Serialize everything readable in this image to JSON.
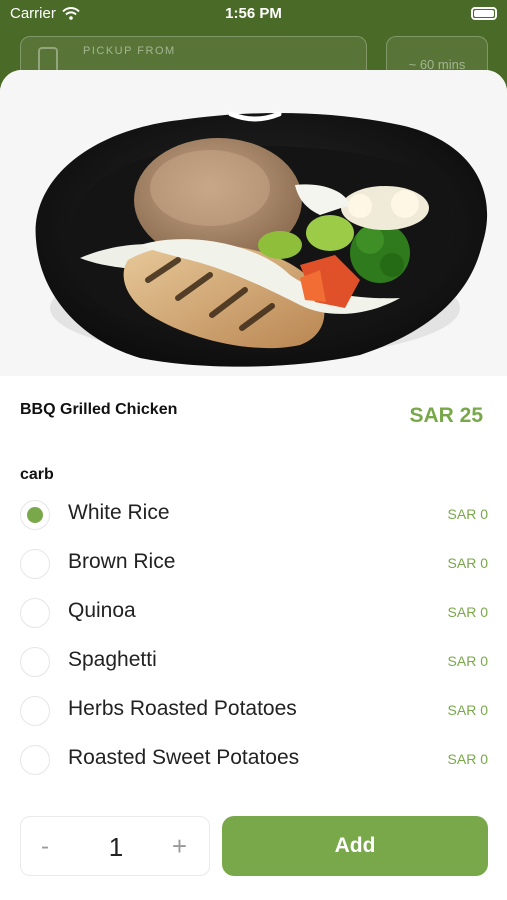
{
  "status_bar": {
    "carrier": "Carrier",
    "time": "1:56 PM"
  },
  "header": {
    "pickup_label": "PICKUP FROM",
    "time_label": "~ 60 mins"
  },
  "product": {
    "name": "BBQ Grilled Chicken",
    "price": "SAR 25"
  },
  "options_group": {
    "title": "carb",
    "options": [
      {
        "label": "White Rice",
        "price": "SAR 0",
        "selected": true
      },
      {
        "label": "Brown Rice",
        "price": "SAR 0",
        "selected": false
      },
      {
        "label": "Quinoa",
        "price": "SAR 0",
        "selected": false
      },
      {
        "label": "Spaghetti",
        "price": "SAR 0",
        "selected": false
      },
      {
        "label": "Herbs Roasted Potatoes",
        "price": "SAR 0",
        "selected": false
      },
      {
        "label": "Roasted Sweet Potatoes",
        "price": "SAR 0",
        "selected": false
      }
    ]
  },
  "quantity": {
    "minus": "-",
    "value": "1",
    "plus": "+"
  },
  "add_button": {
    "label": "Add"
  },
  "colors": {
    "accent": "#79a84a",
    "header_bg": "#4a6a27"
  }
}
